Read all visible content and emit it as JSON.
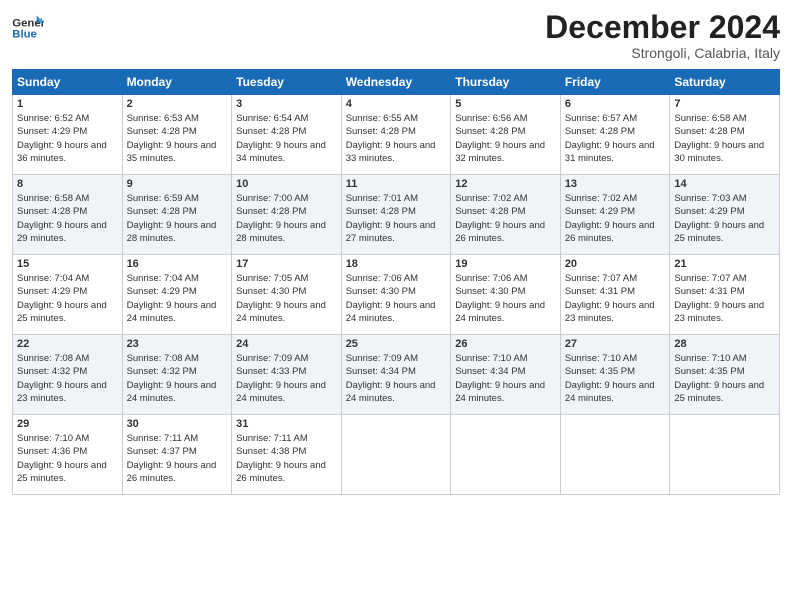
{
  "header": {
    "logo_line1": "General",
    "logo_line2": "Blue",
    "month": "December 2024",
    "location": "Strongoli, Calabria, Italy"
  },
  "days_of_week": [
    "Sunday",
    "Monday",
    "Tuesday",
    "Wednesday",
    "Thursday",
    "Friday",
    "Saturday"
  ],
  "weeks": [
    [
      {
        "day": "1",
        "sunrise": "6:52 AM",
        "sunset": "4:29 PM",
        "daylight": "9 hours and 36 minutes."
      },
      {
        "day": "2",
        "sunrise": "6:53 AM",
        "sunset": "4:28 PM",
        "daylight": "9 hours and 35 minutes."
      },
      {
        "day": "3",
        "sunrise": "6:54 AM",
        "sunset": "4:28 PM",
        "daylight": "9 hours and 34 minutes."
      },
      {
        "day": "4",
        "sunrise": "6:55 AM",
        "sunset": "4:28 PM",
        "daylight": "9 hours and 33 minutes."
      },
      {
        "day": "5",
        "sunrise": "6:56 AM",
        "sunset": "4:28 PM",
        "daylight": "9 hours and 32 minutes."
      },
      {
        "day": "6",
        "sunrise": "6:57 AM",
        "sunset": "4:28 PM",
        "daylight": "9 hours and 31 minutes."
      },
      {
        "day": "7",
        "sunrise": "6:58 AM",
        "sunset": "4:28 PM",
        "daylight": "9 hours and 30 minutes."
      }
    ],
    [
      {
        "day": "8",
        "sunrise": "6:58 AM",
        "sunset": "4:28 PM",
        "daylight": "9 hours and 29 minutes."
      },
      {
        "day": "9",
        "sunrise": "6:59 AM",
        "sunset": "4:28 PM",
        "daylight": "9 hours and 28 minutes."
      },
      {
        "day": "10",
        "sunrise": "7:00 AM",
        "sunset": "4:28 PM",
        "daylight": "9 hours and 28 minutes."
      },
      {
        "day": "11",
        "sunrise": "7:01 AM",
        "sunset": "4:28 PM",
        "daylight": "9 hours and 27 minutes."
      },
      {
        "day": "12",
        "sunrise": "7:02 AM",
        "sunset": "4:28 PM",
        "daylight": "9 hours and 26 minutes."
      },
      {
        "day": "13",
        "sunrise": "7:02 AM",
        "sunset": "4:29 PM",
        "daylight": "9 hours and 26 minutes."
      },
      {
        "day": "14",
        "sunrise": "7:03 AM",
        "sunset": "4:29 PM",
        "daylight": "9 hours and 25 minutes."
      }
    ],
    [
      {
        "day": "15",
        "sunrise": "7:04 AM",
        "sunset": "4:29 PM",
        "daylight": "9 hours and 25 minutes."
      },
      {
        "day": "16",
        "sunrise": "7:04 AM",
        "sunset": "4:29 PM",
        "daylight": "9 hours and 24 minutes."
      },
      {
        "day": "17",
        "sunrise": "7:05 AM",
        "sunset": "4:30 PM",
        "daylight": "9 hours and 24 minutes."
      },
      {
        "day": "18",
        "sunrise": "7:06 AM",
        "sunset": "4:30 PM",
        "daylight": "9 hours and 24 minutes."
      },
      {
        "day": "19",
        "sunrise": "7:06 AM",
        "sunset": "4:30 PM",
        "daylight": "9 hours and 24 minutes."
      },
      {
        "day": "20",
        "sunrise": "7:07 AM",
        "sunset": "4:31 PM",
        "daylight": "9 hours and 23 minutes."
      },
      {
        "day": "21",
        "sunrise": "7:07 AM",
        "sunset": "4:31 PM",
        "daylight": "9 hours and 23 minutes."
      }
    ],
    [
      {
        "day": "22",
        "sunrise": "7:08 AM",
        "sunset": "4:32 PM",
        "daylight": "9 hours and 23 minutes."
      },
      {
        "day": "23",
        "sunrise": "7:08 AM",
        "sunset": "4:32 PM",
        "daylight": "9 hours and 24 minutes."
      },
      {
        "day": "24",
        "sunrise": "7:09 AM",
        "sunset": "4:33 PM",
        "daylight": "9 hours and 24 minutes."
      },
      {
        "day": "25",
        "sunrise": "7:09 AM",
        "sunset": "4:34 PM",
        "daylight": "9 hours and 24 minutes."
      },
      {
        "day": "26",
        "sunrise": "7:10 AM",
        "sunset": "4:34 PM",
        "daylight": "9 hours and 24 minutes."
      },
      {
        "day": "27",
        "sunrise": "7:10 AM",
        "sunset": "4:35 PM",
        "daylight": "9 hours and 24 minutes."
      },
      {
        "day": "28",
        "sunrise": "7:10 AM",
        "sunset": "4:35 PM",
        "daylight": "9 hours and 25 minutes."
      }
    ],
    [
      {
        "day": "29",
        "sunrise": "7:10 AM",
        "sunset": "4:36 PM",
        "daylight": "9 hours and 25 minutes."
      },
      {
        "day": "30",
        "sunrise": "7:11 AM",
        "sunset": "4:37 PM",
        "daylight": "9 hours and 26 minutes."
      },
      {
        "day": "31",
        "sunrise": "7:11 AM",
        "sunset": "4:38 PM",
        "daylight": "9 hours and 26 minutes."
      },
      {
        "day": "",
        "sunrise": "",
        "sunset": "",
        "daylight": ""
      },
      {
        "day": "",
        "sunrise": "",
        "sunset": "",
        "daylight": ""
      },
      {
        "day": "",
        "sunrise": "",
        "sunset": "",
        "daylight": ""
      },
      {
        "day": "",
        "sunrise": "",
        "sunset": "",
        "daylight": ""
      }
    ]
  ],
  "labels": {
    "sunrise_prefix": "Sunrise: ",
    "sunset_prefix": "Sunset: ",
    "daylight_prefix": "Daylight: "
  }
}
